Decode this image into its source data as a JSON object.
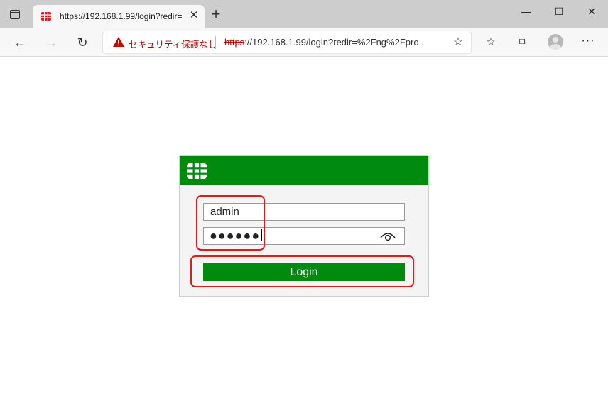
{
  "browser": {
    "tab": {
      "title": "https://192.168.1.99/login?redir="
    },
    "new_tab_symbol": "+",
    "window_controls": {
      "minimize": "—",
      "maximize": "☐",
      "close": "✕"
    },
    "address_bar": {
      "security_label": "セキュリティ保護なし",
      "url_scheme": "https",
      "url_rest": "://192.168.1.99/login?redir=%2Fng%2Fpro..."
    },
    "icons": [
      "back-icon",
      "forward-icon",
      "refresh-icon",
      "warning-icon",
      "add-favorite-icon",
      "favorites-icon",
      "collections-icon",
      "profile-avatar",
      "more-icon"
    ]
  },
  "login": {
    "username_value": "admin",
    "password_dots": "●●●●●●",
    "login_label": "Login",
    "brand_color": "#008a0e",
    "highlight_color": "#e01b1b"
  }
}
